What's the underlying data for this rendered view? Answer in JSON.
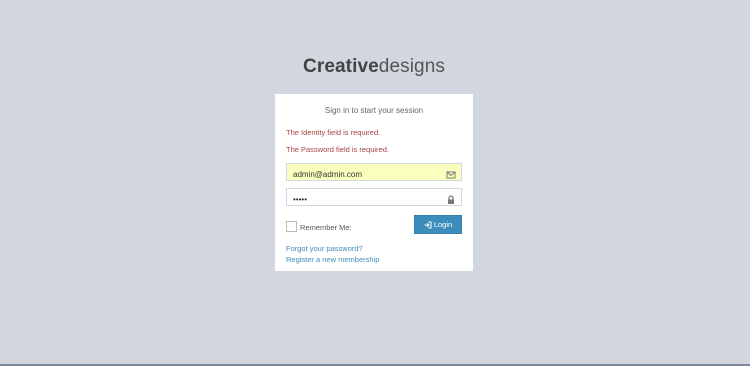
{
  "logo": {
    "bold": "Creative",
    "light": "designs"
  },
  "login_box": {
    "message": "Sign in to start your session",
    "errors": [
      "The Identity field is required.",
      "The Password field is required."
    ],
    "identity": {
      "value": "admin@admin.com",
      "icon": "envelope-icon"
    },
    "password": {
      "value": "•••••",
      "icon": "lock-icon"
    },
    "remember_label": "Remember Me:",
    "login_button": {
      "label": "Login",
      "icon": "sign-in-icon"
    },
    "links": {
      "forgot": "Forgot your password?",
      "register": "Register a new membership"
    }
  },
  "colors": {
    "background": "#d2d6de",
    "error": "#a94442",
    "primary": "#3c8dbc",
    "autofill": "#faffbd"
  }
}
